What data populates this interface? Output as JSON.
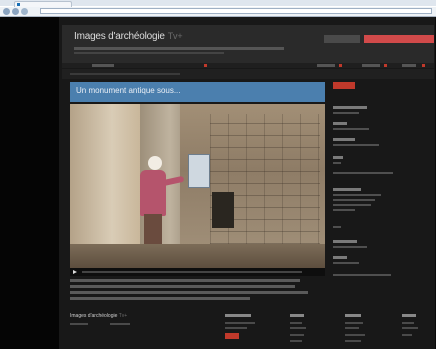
{
  "browser": {
    "tab_title": "",
    "url": ""
  },
  "site": {
    "title": "Images d'archéologie",
    "title_suffix": "Tv+",
    "subscribe_label": ""
  },
  "video": {
    "title": "Un monument antique sous..."
  },
  "sidebar": {
    "badge": ""
  },
  "footer": {
    "title": "Images d'archéologie",
    "title_suffix": "Tv+"
  },
  "colors": {
    "accent": "#c0392b",
    "header_blue": "#4b7fae",
    "background": "#181818"
  }
}
